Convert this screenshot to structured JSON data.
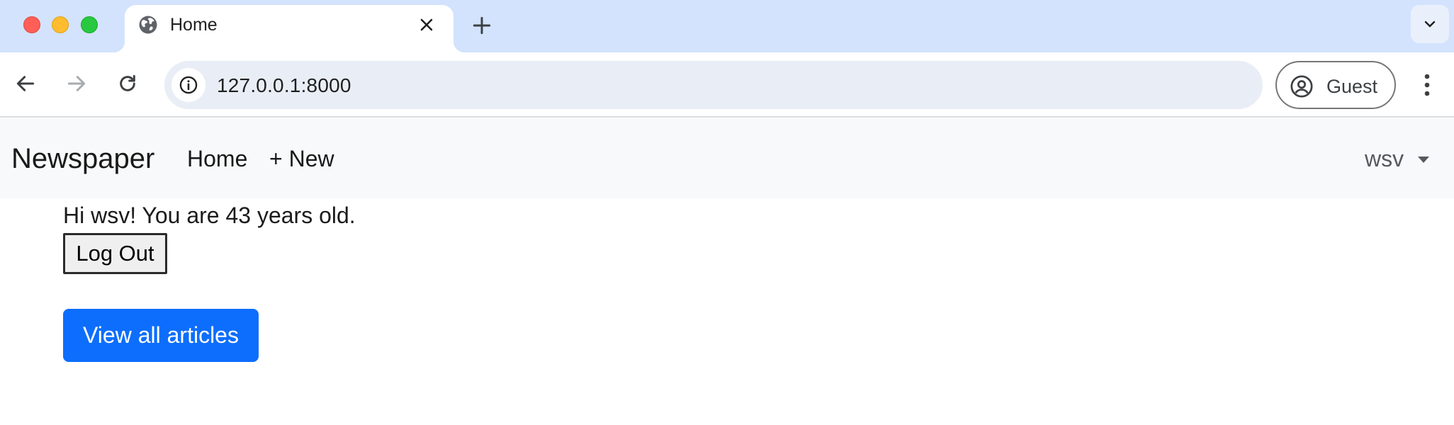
{
  "browser": {
    "tab": {
      "title": "Home",
      "favicon": "globe-icon"
    },
    "address_bar": {
      "url": "127.0.0.1:8000"
    },
    "profile": {
      "label": "Guest"
    }
  },
  "page": {
    "navbar": {
      "brand": "Newspaper",
      "links": [
        "Home",
        "+ New"
      ],
      "user_menu": "wsv"
    },
    "greeting": "Hi wsv! You are 43 years old.",
    "logout_label": "Log Out",
    "view_all_label": "View all articles"
  },
  "colors": {
    "tabstrip": "#d3e3fd",
    "navbar_bg": "#f8f9fa",
    "primary_button": "#0d6efd"
  }
}
